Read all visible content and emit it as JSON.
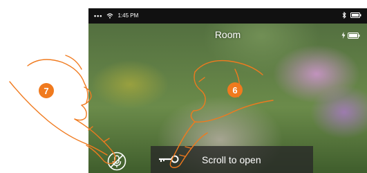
{
  "statusbar": {
    "time": "1:45 PM"
  },
  "header": {
    "title": "Room"
  },
  "bottom_bar": {
    "label": "Scroll to open"
  },
  "callouts": [
    {
      "number": "7"
    },
    {
      "number": "6"
    }
  ],
  "colors": {
    "callout": "#f07a1e",
    "bar": "#282828"
  },
  "icons": [
    "wifi-icon",
    "bluetooth-icon",
    "battery-icon",
    "key-icon",
    "mute-microphone-icon"
  ]
}
